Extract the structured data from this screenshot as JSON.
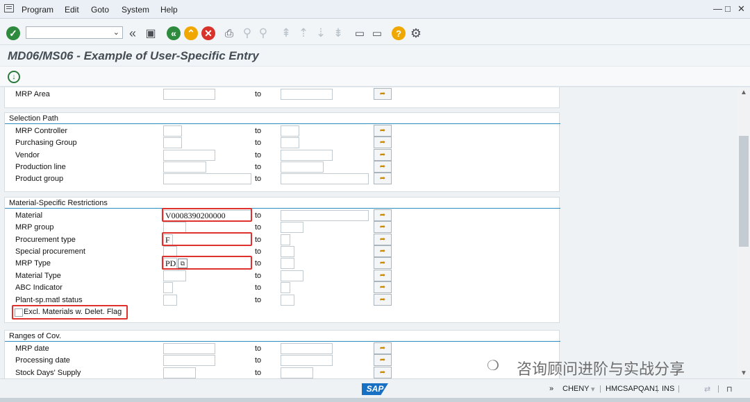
{
  "menu": {
    "items": [
      "Program",
      "Edit",
      "Goto",
      "System",
      "Help"
    ],
    "window_controls": [
      "—",
      "□",
      "✕"
    ]
  },
  "toolbar": {
    "command_value": "",
    "icons": [
      "enter-icon",
      "back-double-icon",
      "save-icon",
      "back-icon",
      "exit-icon",
      "cancel-icon",
      "print-icon",
      "find-icon",
      "find-next-icon",
      "first-page-icon",
      "previous-page-icon",
      "next-page-icon",
      "last-page-icon",
      "create-session-icon",
      "shortcut-icon",
      "help-icon",
      "customize-layout-icon"
    ]
  },
  "title": "MD06/MS06 - Example of User-Specific Entry",
  "sections": {
    "top": {
      "mrp_area": {
        "label": "MRP Area",
        "to": "to",
        "from": "",
        "to_value": ""
      }
    },
    "selection_path": {
      "title": "Selection Path",
      "rows": [
        {
          "label": "MRP Controller",
          "to": "to",
          "from": "",
          "to_value": ""
        },
        {
          "label": "Purchasing Group",
          "to": "to",
          "from": "",
          "to_value": ""
        },
        {
          "label": "Vendor",
          "to": "to",
          "from": "",
          "to_value": ""
        },
        {
          "label": "Production line",
          "to": "to",
          "from": "",
          "to_value": ""
        },
        {
          "label": "Product group",
          "to": "to",
          "from": "",
          "to_value": ""
        }
      ]
    },
    "material_restrictions": {
      "title": "Material-Specific Restrictions",
      "rows": [
        {
          "label": "Material",
          "to": "to",
          "from": "V0008390200000",
          "to_value": ""
        },
        {
          "label": "MRP group",
          "to": "to",
          "from": "",
          "to_value": ""
        },
        {
          "label": "Procurement type",
          "to": "to",
          "from": "F",
          "to_value": ""
        },
        {
          "label": "Special procurement",
          "to": "to",
          "from": "",
          "to_value": ""
        },
        {
          "label": "MRP Type",
          "to": "to",
          "from": "PD",
          "to_value": ""
        },
        {
          "label": "Material Type",
          "to": "to",
          "from": "",
          "to_value": ""
        },
        {
          "label": "ABC Indicator",
          "to": "to",
          "from": "",
          "to_value": ""
        },
        {
          "label": "Plant-sp.matl status",
          "to": "to",
          "from": "",
          "to_value": ""
        }
      ],
      "checkbox_label": "Excl. Materials w. Delet. Flag",
      "checkbox_checked": false
    },
    "ranges_of_cov": {
      "title": "Ranges of Cov.",
      "rows": [
        {
          "label": "MRP date",
          "to": "to",
          "from": "",
          "to_value": ""
        },
        {
          "label": "Processing date",
          "to": "to",
          "from": "",
          "to_value": ""
        },
        {
          "label": "Stock Days' Supply",
          "to": "to",
          "from": "",
          "to_value": ""
        }
      ]
    }
  },
  "watermark": "咨询顾问进阶与实战分享",
  "statusbar": {
    "sap_logo": "SAP",
    "arrows": "»",
    "user": "CHENY",
    "system": "HMCSAPQAN1",
    "mode": "INS"
  },
  "colors": {
    "highlight": "#e0302b",
    "section_line": "#2a8bbf",
    "enter_green": "#2e8b3e",
    "nav_orange": "#f0a800",
    "cancel_red": "#d9322b"
  }
}
